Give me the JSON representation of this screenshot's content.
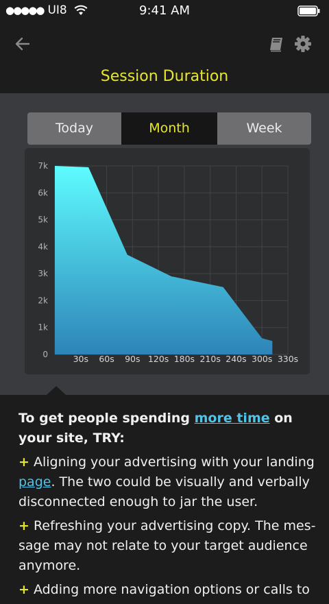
{
  "status_bar": {
    "signal": "●●●●●",
    "carrier": "UI8",
    "time": "9:41 AM"
  },
  "nav": {
    "back_icon": "back-arrow-icon",
    "book_icon": "book-icon",
    "settings_icon": "gear-icon"
  },
  "title": "Session Duration",
  "tabs": [
    {
      "label": "Today",
      "active": false
    },
    {
      "label": "Month",
      "active": true
    },
    {
      "label": "Week",
      "active": false
    }
  ],
  "colors": {
    "accent": "#e8e62c",
    "link": "#4fc3e8",
    "chart_top": "#5efcff",
    "chart_bottom": "#2e84b8"
  },
  "chart_data": {
    "type": "area",
    "y_ticks": [
      "0",
      "1k",
      "2k",
      "3k",
      "4k",
      "5k",
      "6k",
      "7k"
    ],
    "x_ticks": [
      "30s",
      "60s",
      "90s",
      "120s",
      "180s",
      "210s",
      "240s",
      "300s",
      "330s"
    ],
    "ylim": [
      0,
      7000
    ],
    "grid": true,
    "points": [
      {
        "x": 0,
        "y": 7000
      },
      {
        "x": 1.3,
        "y": 6950
      },
      {
        "x": 2.8,
        "y": 3700
      },
      {
        "x": 4.5,
        "y": 2900
      },
      {
        "x": 5,
        "y": 2800
      },
      {
        "x": 6.5,
        "y": 2500
      },
      {
        "x": 8,
        "y": 600
      },
      {
        "x": 8.4,
        "y": 500
      }
    ]
  },
  "tips": {
    "intro_before": "To get people spending ",
    "intro_link": "more time",
    "intro_after": " on your site, TRY:",
    "items": [
      {
        "before": " Aligning your advertising with your landing ",
        "link": "page",
        "after": ". The two could be visually and verbally disconnected enough to jar the user."
      },
      {
        "before": " Refreshing your advertising copy. The mes-sage may not relate to your target audience anymore.",
        "link": "",
        "after": ""
      },
      {
        "before": " Adding more navigation options or calls to",
        "link": "",
        "after": ""
      }
    ]
  }
}
